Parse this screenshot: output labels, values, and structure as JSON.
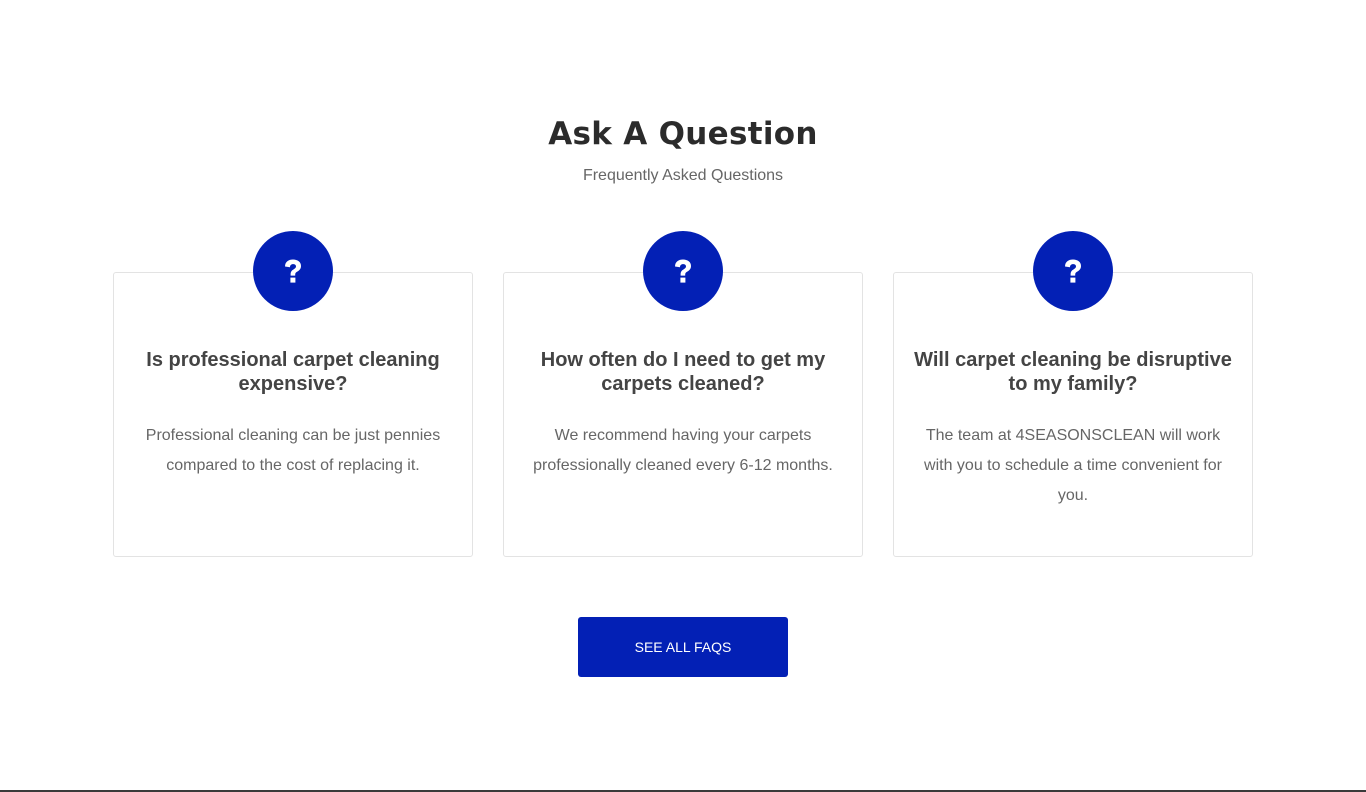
{
  "section": {
    "title": "Ask A Question",
    "subtitle": "Frequently Asked Questions"
  },
  "cards": [
    {
      "icon": "question-mark-icon",
      "question": "Is professional carpet cleaning expensive?",
      "answer": "Professional cleaning can be just pennies compared to the cost of replacing it."
    },
    {
      "icon": "question-mark-icon",
      "question": "How often do I need to get my carpets cleaned?",
      "answer": "We recommend having your carpets professionally cleaned every 6-12 months."
    },
    {
      "icon": "question-mark-icon",
      "question": "Will carpet cleaning be disruptive to my family?",
      "answer": "The team at 4SEASONSCLEAN will work with you to schedule a time convenient for you."
    }
  ],
  "cta": {
    "label": "SEE ALL FAQS"
  },
  "colors": {
    "accent": "#0320b5",
    "title": "#2b2b2b",
    "body_text": "#666666",
    "card_border": "#e3e3e3"
  }
}
